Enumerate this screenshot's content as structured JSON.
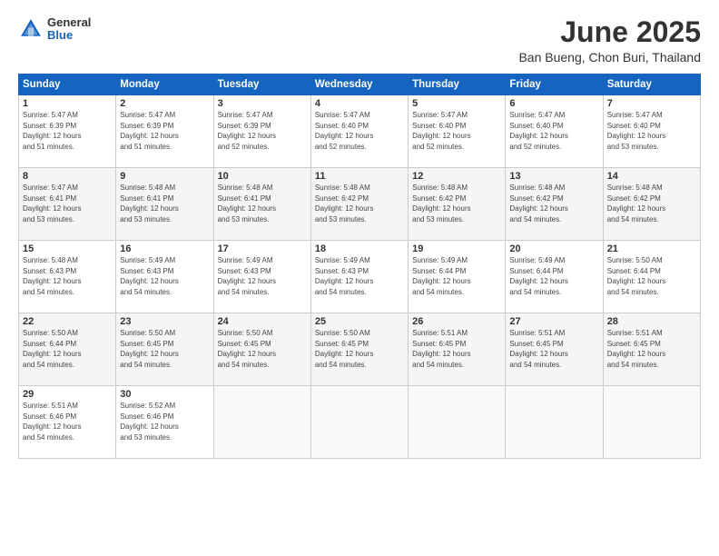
{
  "header": {
    "logo_general": "General",
    "logo_blue": "Blue",
    "title": "June 2025",
    "subtitle": "Ban Bueng, Chon Buri, Thailand"
  },
  "weekdays": [
    "Sunday",
    "Monday",
    "Tuesday",
    "Wednesday",
    "Thursday",
    "Friday",
    "Saturday"
  ],
  "weeks": [
    [
      {
        "day": "1",
        "info": "Sunrise: 5:47 AM\nSunset: 6:39 PM\nDaylight: 12 hours\nand 51 minutes."
      },
      {
        "day": "2",
        "info": "Sunrise: 5:47 AM\nSunset: 6:39 PM\nDaylight: 12 hours\nand 51 minutes."
      },
      {
        "day": "3",
        "info": "Sunrise: 5:47 AM\nSunset: 6:39 PM\nDaylight: 12 hours\nand 52 minutes."
      },
      {
        "day": "4",
        "info": "Sunrise: 5:47 AM\nSunset: 6:40 PM\nDaylight: 12 hours\nand 52 minutes."
      },
      {
        "day": "5",
        "info": "Sunrise: 5:47 AM\nSunset: 6:40 PM\nDaylight: 12 hours\nand 52 minutes."
      },
      {
        "day": "6",
        "info": "Sunrise: 5:47 AM\nSunset: 6:40 PM\nDaylight: 12 hours\nand 52 minutes."
      },
      {
        "day": "7",
        "info": "Sunrise: 5:47 AM\nSunset: 6:40 PM\nDaylight: 12 hours\nand 53 minutes."
      }
    ],
    [
      {
        "day": "8",
        "info": "Sunrise: 5:47 AM\nSunset: 6:41 PM\nDaylight: 12 hours\nand 53 minutes."
      },
      {
        "day": "9",
        "info": "Sunrise: 5:48 AM\nSunset: 6:41 PM\nDaylight: 12 hours\nand 53 minutes."
      },
      {
        "day": "10",
        "info": "Sunrise: 5:48 AM\nSunset: 6:41 PM\nDaylight: 12 hours\nand 53 minutes."
      },
      {
        "day": "11",
        "info": "Sunrise: 5:48 AM\nSunset: 6:42 PM\nDaylight: 12 hours\nand 53 minutes."
      },
      {
        "day": "12",
        "info": "Sunrise: 5:48 AM\nSunset: 6:42 PM\nDaylight: 12 hours\nand 53 minutes."
      },
      {
        "day": "13",
        "info": "Sunrise: 5:48 AM\nSunset: 6:42 PM\nDaylight: 12 hours\nand 54 minutes."
      },
      {
        "day": "14",
        "info": "Sunrise: 5:48 AM\nSunset: 6:42 PM\nDaylight: 12 hours\nand 54 minutes."
      }
    ],
    [
      {
        "day": "15",
        "info": "Sunrise: 5:48 AM\nSunset: 6:43 PM\nDaylight: 12 hours\nand 54 minutes."
      },
      {
        "day": "16",
        "info": "Sunrise: 5:49 AM\nSunset: 6:43 PM\nDaylight: 12 hours\nand 54 minutes."
      },
      {
        "day": "17",
        "info": "Sunrise: 5:49 AM\nSunset: 6:43 PM\nDaylight: 12 hours\nand 54 minutes."
      },
      {
        "day": "18",
        "info": "Sunrise: 5:49 AM\nSunset: 6:43 PM\nDaylight: 12 hours\nand 54 minutes."
      },
      {
        "day": "19",
        "info": "Sunrise: 5:49 AM\nSunset: 6:44 PM\nDaylight: 12 hours\nand 54 minutes."
      },
      {
        "day": "20",
        "info": "Sunrise: 5:49 AM\nSunset: 6:44 PM\nDaylight: 12 hours\nand 54 minutes."
      },
      {
        "day": "21",
        "info": "Sunrise: 5:50 AM\nSunset: 6:44 PM\nDaylight: 12 hours\nand 54 minutes."
      }
    ],
    [
      {
        "day": "22",
        "info": "Sunrise: 5:50 AM\nSunset: 6:44 PM\nDaylight: 12 hours\nand 54 minutes."
      },
      {
        "day": "23",
        "info": "Sunrise: 5:50 AM\nSunset: 6:45 PM\nDaylight: 12 hours\nand 54 minutes."
      },
      {
        "day": "24",
        "info": "Sunrise: 5:50 AM\nSunset: 6:45 PM\nDaylight: 12 hours\nand 54 minutes."
      },
      {
        "day": "25",
        "info": "Sunrise: 5:50 AM\nSunset: 6:45 PM\nDaylight: 12 hours\nand 54 minutes."
      },
      {
        "day": "26",
        "info": "Sunrise: 5:51 AM\nSunset: 6:45 PM\nDaylight: 12 hours\nand 54 minutes."
      },
      {
        "day": "27",
        "info": "Sunrise: 5:51 AM\nSunset: 6:45 PM\nDaylight: 12 hours\nand 54 minutes."
      },
      {
        "day": "28",
        "info": "Sunrise: 5:51 AM\nSunset: 6:45 PM\nDaylight: 12 hours\nand 54 minutes."
      }
    ],
    [
      {
        "day": "29",
        "info": "Sunrise: 5:51 AM\nSunset: 6:46 PM\nDaylight: 12 hours\nand 54 minutes."
      },
      {
        "day": "30",
        "info": "Sunrise: 5:52 AM\nSunset: 6:46 PM\nDaylight: 12 hours\nand 53 minutes."
      },
      {
        "day": "",
        "info": ""
      },
      {
        "day": "",
        "info": ""
      },
      {
        "day": "",
        "info": ""
      },
      {
        "day": "",
        "info": ""
      },
      {
        "day": "",
        "info": ""
      }
    ]
  ]
}
